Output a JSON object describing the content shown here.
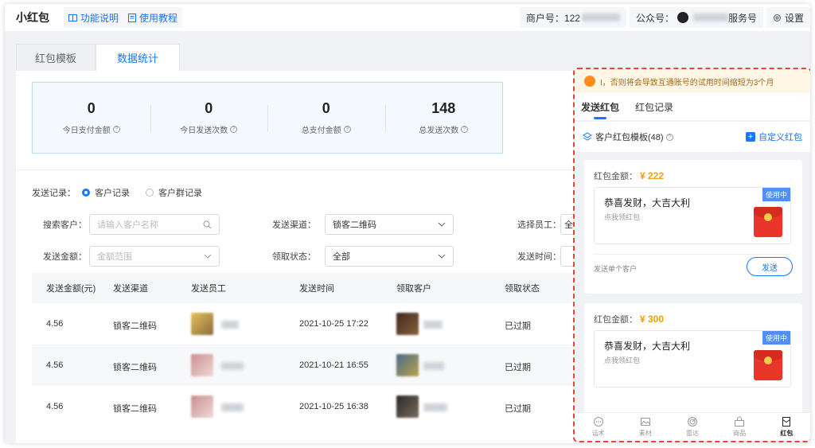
{
  "app": {
    "title": "小红包"
  },
  "header": {
    "links": [
      "功能说明",
      "使用教程"
    ],
    "merchant_label": "商户号：122",
    "gzh_label": "公众号：",
    "gzh_suffix": "服务号",
    "settings_label": "设置"
  },
  "tabs": [
    {
      "label": "红包模板",
      "active": false
    },
    {
      "label": "数据统计",
      "active": true
    }
  ],
  "stats": [
    {
      "value": "0",
      "label": "今日支付金额"
    },
    {
      "value": "0",
      "label": "今日发送次数"
    },
    {
      "value": "0",
      "label": "总支付金额"
    },
    {
      "value": "148",
      "label": "总发送次数"
    }
  ],
  "filters": {
    "record_label": "发送记录：",
    "record_options": [
      "客户记录",
      "客户群记录"
    ],
    "search_label": "搜索客户：",
    "search_placeholder": "请输入客户名称",
    "channel_label": "发送渠道：",
    "channel_value": "锁客二维码",
    "staff_label": "选择员工：",
    "staff_value": "全",
    "amount_label": "发送金额：",
    "amount_placeholder": "金额范围",
    "status_label": "领取状态：",
    "status_value": "全部",
    "time_label": "发送时间："
  },
  "table": {
    "columns": [
      "发送金额(元)",
      "发送渠道",
      "发送员工",
      "发送时间",
      "领取客户",
      "领取状态"
    ],
    "rows": [
      {
        "amount": "4.56",
        "channel": "锁客二维码",
        "time": "2021-10-25 17:22",
        "status": "已过期"
      },
      {
        "amount": "4.56",
        "channel": "锁客二维码",
        "time": "2021-10-21 16:55",
        "status": "已过期"
      },
      {
        "amount": "4.56",
        "channel": "锁客二维码",
        "time": "2021-10-25 16:38",
        "status": "已过期"
      }
    ]
  },
  "phone": {
    "notice": "I，否则将会导致互通账号的试用时间缩短为3个月",
    "tabs": [
      "发送红包",
      "红包记录"
    ],
    "template_title": "客户红包模板(48)",
    "custom_label": "自定义红包",
    "cards": [
      {
        "amount_label": "红包金额：",
        "amount": "¥ 222",
        "title": "恭喜发财，大吉大利",
        "subtitle": "点我领红包",
        "tag": "使用中",
        "footer": "发送单个客户",
        "send": "发送"
      },
      {
        "amount_label": "红包金额：",
        "amount": "¥ 300",
        "title": "恭喜发财，大吉大利",
        "subtitle": "点我领红包",
        "tag": "使用中"
      }
    ],
    "nav": [
      {
        "label": "话术",
        "icon": "chat-icon"
      },
      {
        "label": "素材",
        "icon": "image-icon"
      },
      {
        "label": "雷达",
        "icon": "radar-icon"
      },
      {
        "label": "商品",
        "icon": "shop-icon"
      },
      {
        "label": "红包",
        "icon": "envelope-icon",
        "active": true
      }
    ]
  },
  "colors": {
    "accent": "#1677ff",
    "highlight_border": "#e0483d",
    "amount": "#f0a000"
  }
}
